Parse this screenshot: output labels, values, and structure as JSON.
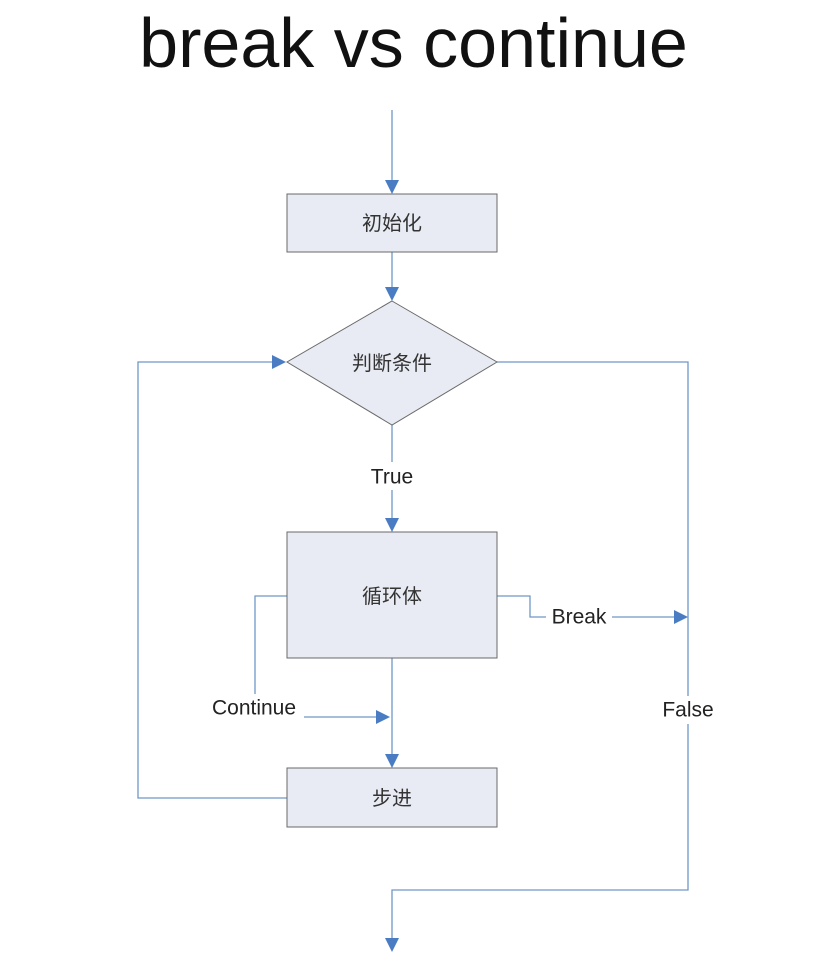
{
  "title": "break vs continue",
  "nodes": {
    "init": "初始化",
    "condition": "判断条件",
    "body": "循环体",
    "step": "步进"
  },
  "edge_labels": {
    "true": "True",
    "false": "False",
    "break": "Break",
    "continue": "Continue"
  },
  "colors": {
    "line": "#6f97c8",
    "arrow": "#4a7cc3",
    "box_fill": "#e8ebf3",
    "box_border": "#6a6a6a"
  }
}
